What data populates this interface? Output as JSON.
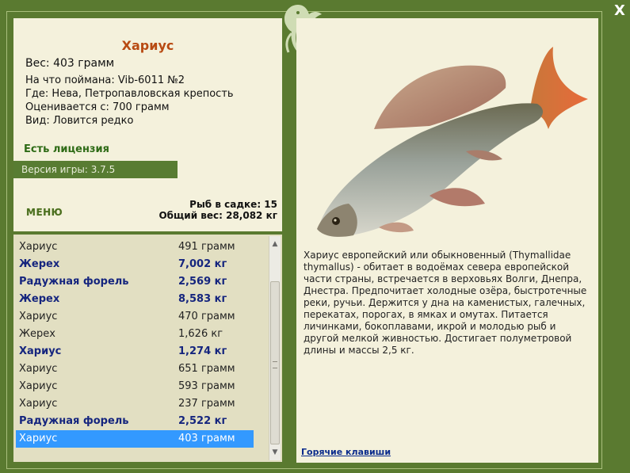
{
  "info": {
    "fish_name": "Хариус",
    "weight": "Вес: 403 грамм",
    "details": [
      "На что поймана: Vib-6011 №2",
      "Где: Нева, Петропавловская крепость",
      "Оценивается с: 700 грамм",
      "Вид: Ловится редко"
    ],
    "license": "Есть лицензия",
    "version": "Версия игры: 3.7.5",
    "menu_label": "МЕНЮ",
    "fish_in_net": "Рыб в садке: 15",
    "total_weight": "Общий вес: 28,082 кг"
  },
  "catch_list": [
    {
      "name": "Хариус",
      "weight": "491 грамм",
      "heavy": false
    },
    {
      "name": "Жерех",
      "weight": "7,002 кг",
      "heavy": true
    },
    {
      "name": "Радужная форель",
      "weight": "2,569 кг",
      "heavy": true
    },
    {
      "name": "Жерех",
      "weight": "8,583 кг",
      "heavy": true
    },
    {
      "name": "Хариус",
      "weight": "470 грамм",
      "heavy": false
    },
    {
      "name": "Жерех",
      "weight": "1,626 кг",
      "heavy": false
    },
    {
      "name": "Хариус",
      "weight": "1,274 кг",
      "heavy": true
    },
    {
      "name": "Хариус",
      "weight": "651 грамм",
      "heavy": false
    },
    {
      "name": "Хариус",
      "weight": "593 грамм",
      "heavy": false
    },
    {
      "name": "Хариус",
      "weight": "237 грамм",
      "heavy": false
    },
    {
      "name": "Радужная форель",
      "weight": "2,522 кг",
      "heavy": true
    },
    {
      "name": "Хариус",
      "weight": "403 грамм",
      "heavy": false,
      "selected": true
    }
  ],
  "description": "Хариус европейский или обыкновенный (Thymallidae thymallus) - обитает в водоёмах севера европейской части страны, встречается в верховьях Волги, Днепра, Днестра. Предпочитает холодные озёра, быстротечные реки, ручьи. Держится у дна на каменистых, галечных, перекатах, порогах, в ямках и омутах. Питается личинками, бокоплавами, икрой и молодью рыб и другой мелкой живностью. Достигает полуметровой длины и массы 2,5 кг.",
  "hotkeys_label": "Горячие клавиши",
  "close_label": "X",
  "icons": {
    "close": "close-icon",
    "ornament": "fish-ornament-icon",
    "scroll_up": "scroll-up-arrow-icon",
    "scroll_down": "scroll-down-arrow-icon"
  },
  "colors": {
    "frame": "#5a7a30",
    "panel": "#f4f1dc",
    "list_bg": "#e2dfc2",
    "fish_name": "#b84a12",
    "license": "#2e6b16",
    "heavy_catch": "#15257e",
    "selected_row": "#3399ff",
    "link": "#0a2b8c"
  }
}
